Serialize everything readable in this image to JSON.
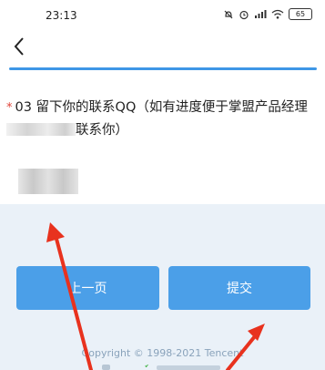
{
  "status_bar": {
    "time": "23:13",
    "battery": "65",
    "icons": [
      "alarm-off-icon",
      "alarm-icon",
      "signal-icon",
      "wifi-icon",
      "battery-icon"
    ]
  },
  "nav": {
    "back_icon": "chevron-left-icon"
  },
  "question": {
    "required_mark": "*",
    "text_before": "03  留下你的联系QQ（如有进度便于掌盟产品经理",
    "text_after": "联系你）"
  },
  "buttons": {
    "prev": "上一页",
    "submit": "提交"
  },
  "footer": {
    "copyright": "Copyright © 1998-2021 Tencent"
  },
  "colors": {
    "accent": "#3e97e6",
    "button": "#4b9fe8",
    "required": "#e0453a",
    "annotation_arrow": "#e8321e"
  }
}
